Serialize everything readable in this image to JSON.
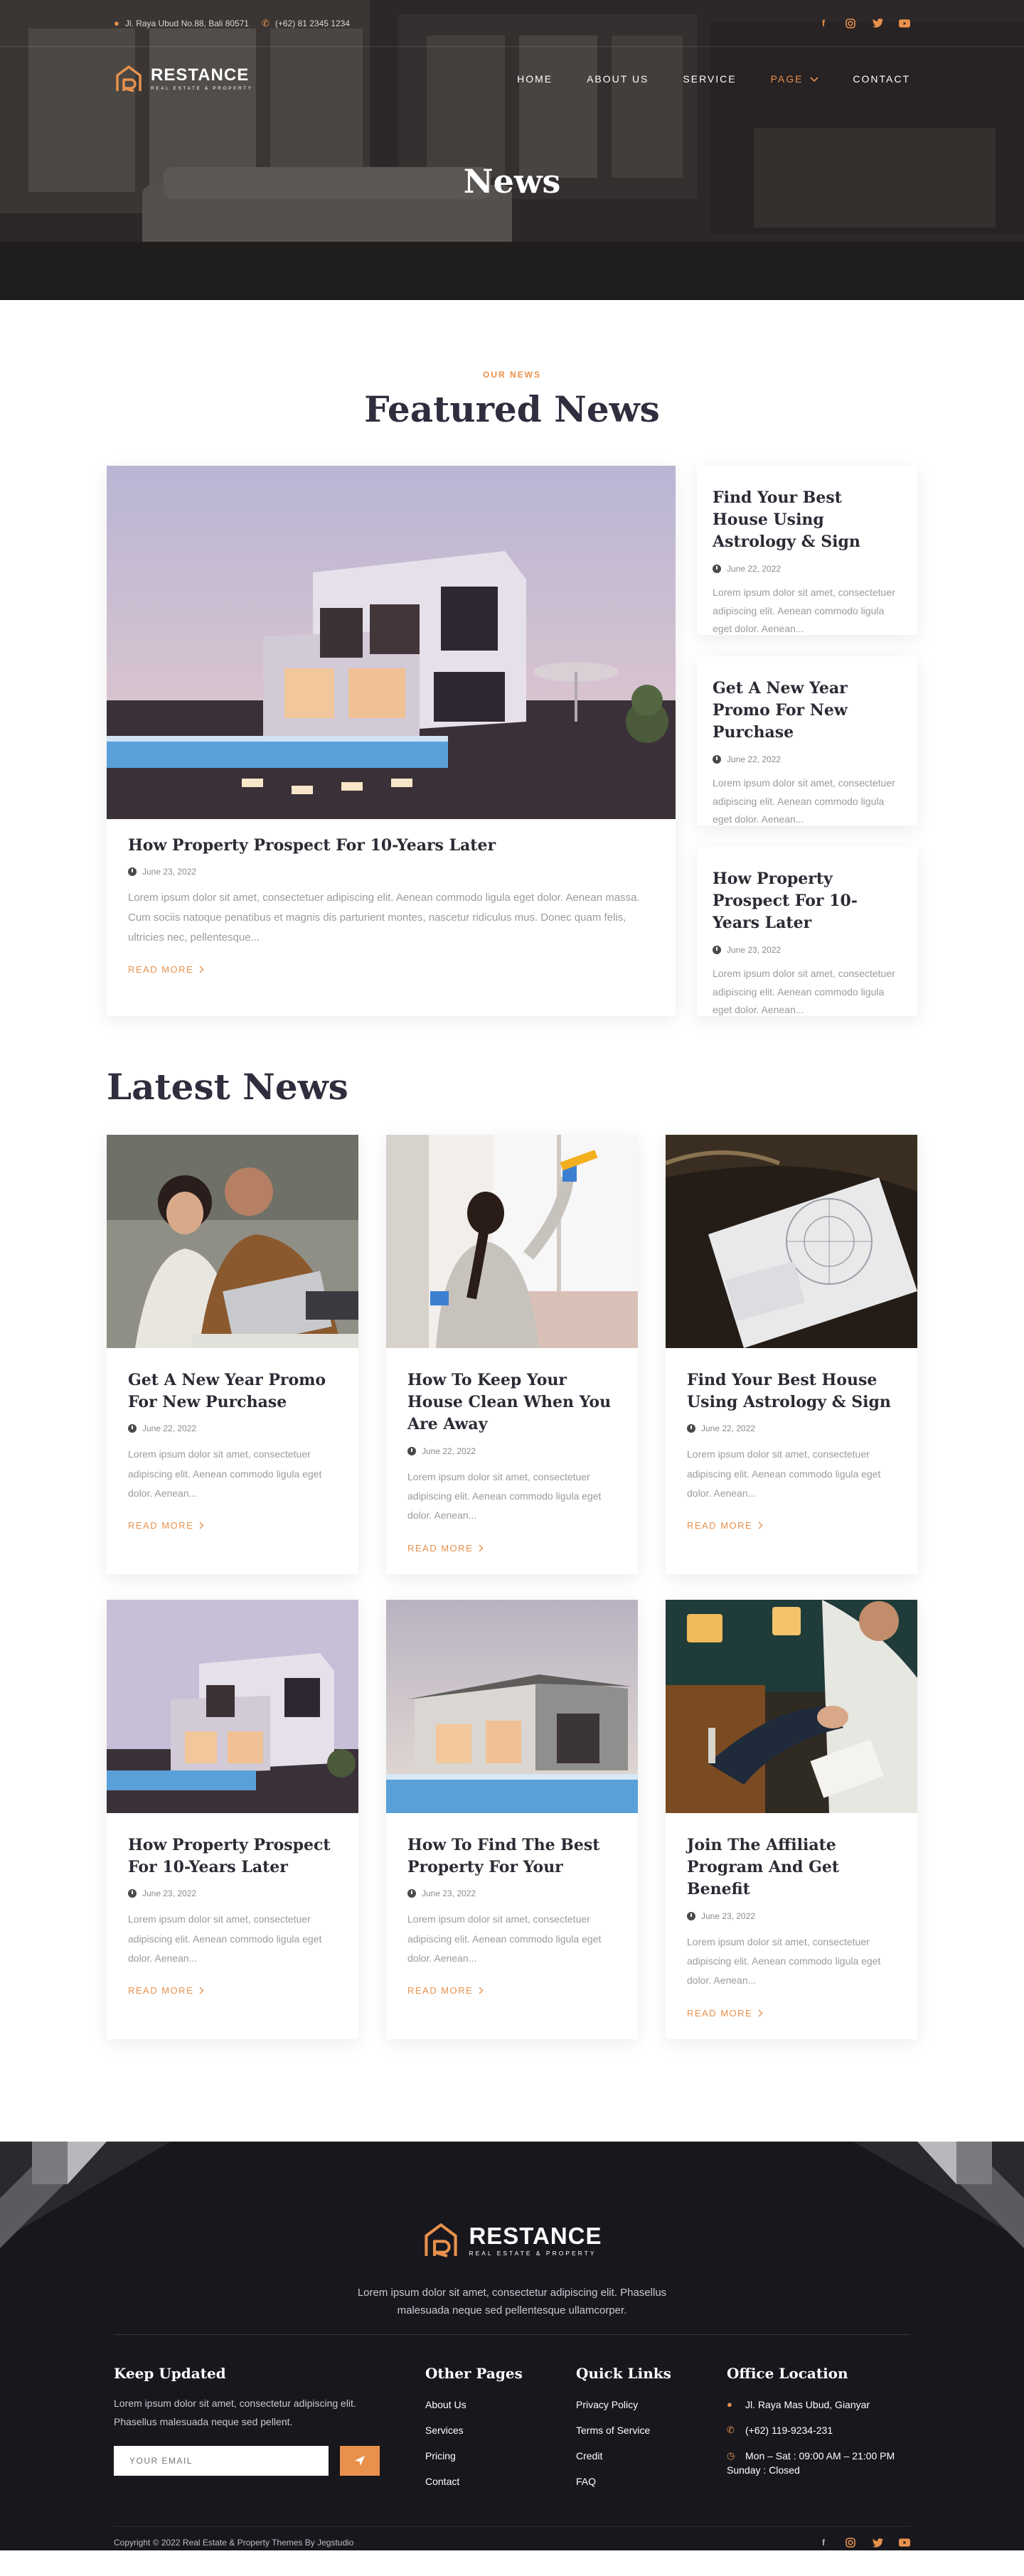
{
  "topbar": {
    "address": "Jl. Raya Ubud No.88, Bali 80571",
    "phone": "(+62) 81 2345 1234",
    "social_icons": [
      "facebook-icon",
      "instagram-icon",
      "twitter-icon",
      "youtube-icon"
    ]
  },
  "brand": {
    "name": "RESTANCE",
    "tagline": "REAL ESTATE & PROPERTY",
    "accent": "#e8914c"
  },
  "nav": {
    "items": [
      "HOME",
      "ABOUT US",
      "SERVICE",
      "PAGE",
      "CONTACT"
    ],
    "active": "PAGE"
  },
  "hero": {
    "title": "News"
  },
  "featured": {
    "eyebrow": "OUR NEWS",
    "title": "Featured News",
    "main": {
      "title": "How Property Prospect For 10-Years Later",
      "date": "June 23, 2022",
      "excerpt": "Lorem ipsum dolor sit amet, consectetuer adipiscing elit. Aenean commodo ligula eget dolor. Aenean massa. Cum sociis natoque penatibus et magnis dis parturient montes, nascetur ridiculus mus. Donec quam felis, ultricies nec, pellentesque...",
      "read_more": "READ MORE"
    },
    "side": [
      {
        "title": "Find Your Best House Using Astrology & Sign",
        "date": "June 22, 2022",
        "excerpt": "Lorem ipsum dolor sit amet, consectetuer adipiscing elit. Aenean commodo ligula eget dolor. Aenean..."
      },
      {
        "title": "Get A New Year Promo For New Purchase",
        "date": "June 22, 2022",
        "excerpt": "Lorem ipsum dolor sit amet, consectetuer adipiscing elit. Aenean commodo ligula eget dolor. Aenean..."
      },
      {
        "title": "How Property Prospect For 10-Years Later",
        "date": "June 23, 2022",
        "excerpt": "Lorem ipsum dolor sit amet, consectetuer adipiscing elit. Aenean commodo ligula eget dolor. Aenean..."
      }
    ]
  },
  "latest": {
    "title": "Latest News",
    "cards": [
      {
        "title": "Get A New Year Promo For New Purchase",
        "date": "June 22, 2022",
        "excerpt": "Lorem ipsum dolor sit amet, consectetuer adipiscing elit. Aenean commodo ligula eget dolor. Aenean...",
        "read_more": "READ MORE"
      },
      {
        "title": "How To Keep Your House Clean When You Are Away",
        "date": "June 22, 2022",
        "excerpt": "Lorem ipsum dolor sit amet, consectetuer adipiscing elit. Aenean commodo ligula eget dolor. Aenean...",
        "read_more": "READ MORE"
      },
      {
        "title": "Find Your Best House Using Astrology & Sign",
        "date": "June 22, 2022",
        "excerpt": "Lorem ipsum dolor sit amet, consectetuer adipiscing elit. Aenean commodo ligula eget dolor. Aenean...",
        "read_more": "READ MORE"
      },
      {
        "title": "How Property Prospect For 10-Years Later",
        "date": "June 23, 2022",
        "excerpt": "Lorem ipsum dolor sit amet, consectetuer adipiscing elit. Aenean commodo ligula eget dolor. Aenean...",
        "read_more": "READ MORE"
      },
      {
        "title": "How To Find The Best Property For Your",
        "date": "June 23, 2022",
        "excerpt": "Lorem ipsum dolor sit amet, consectetuer adipiscing elit. Aenean commodo ligula eget dolor. Aenean...",
        "read_more": "READ MORE"
      },
      {
        "title": "Join The Affiliate Program And Get Benefit",
        "date": "June 23, 2022",
        "excerpt": "Lorem ipsum dolor sit amet, consectetuer adipiscing elit. Aenean commodo ligula eget dolor. Aenean...",
        "read_more": "READ MORE"
      }
    ]
  },
  "footer": {
    "description": "Lorem ipsum dolor sit amet, consectetur adipiscing elit. Phasellus malesuada neque sed pellentesque ullamcorper.",
    "keep_updated": {
      "title": "Keep Updated",
      "text": "Lorem ipsum dolor sit amet, consectetur adipiscing elit. Phasellus malesuada neque sed pellent.",
      "placeholder": "YOUR EMAIL"
    },
    "other_pages": {
      "title": "Other Pages",
      "items": [
        "About Us",
        "Services",
        "Pricing",
        "Contact"
      ]
    },
    "quick_links": {
      "title": "Quick Links",
      "items": [
        "Privacy Policy",
        "Terms of Service",
        "Credit",
        "FAQ"
      ]
    },
    "office": {
      "title": "Office Location",
      "address": "Jl. Raya Mas Ubud, Gianyar",
      "phone": "(+62) 119-9234-231",
      "hours": "Mon – Sat : 09:00 AM – 21:00 PM",
      "sunday": "Sunday : Closed"
    },
    "copyright": "Copyright © 2022 Real Estate & Property Themes By Jegstudio"
  }
}
